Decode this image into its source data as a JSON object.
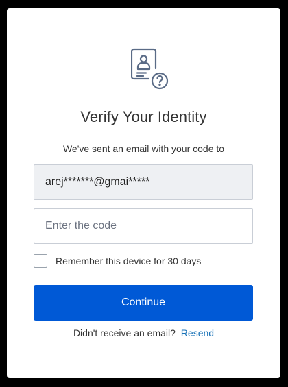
{
  "verify": {
    "title": "Verify Your Identity",
    "subtitle": "We've sent an email with your code to",
    "email_masked": "arej*******@gmai*****",
    "code_placeholder": "Enter the code",
    "remember_label": "Remember this device for 30 days",
    "remember_checked": false,
    "continue_label": "Continue",
    "resend_prompt": "Didn't receive an email?",
    "resend_link": "Resend",
    "icon": "identity-verification-icon"
  },
  "colors": {
    "primary": "#0059d6",
    "link": "#1a73b8",
    "icon": "#5a6b86",
    "background": "#000000"
  }
}
